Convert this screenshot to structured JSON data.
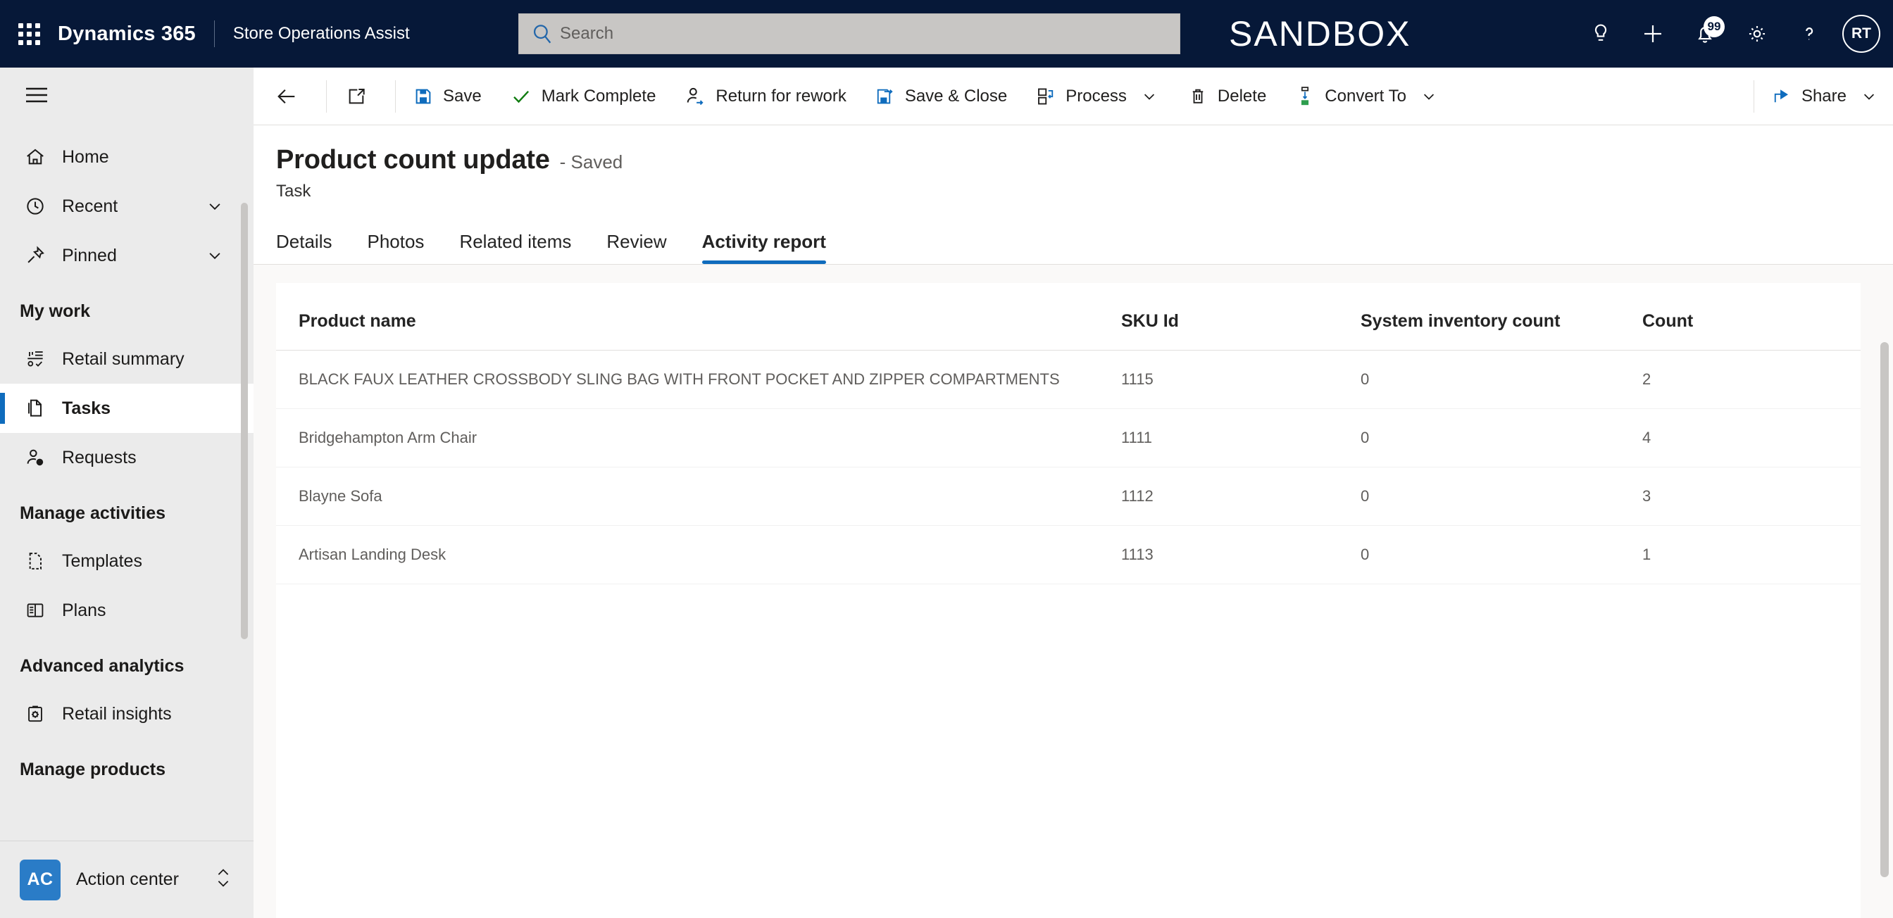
{
  "header": {
    "waffle_label": "app-launcher",
    "brand": "Dynamics 365",
    "app_name": "Store Operations Assist",
    "search_placeholder": "Search",
    "search_value": "",
    "environment_label": "SANDBOX",
    "notification_badge": "99",
    "avatar_initials": "RT",
    "icons": [
      "lightbulb-icon",
      "plus-icon",
      "bell-icon",
      "gear-icon",
      "help-icon"
    ]
  },
  "sidebar": {
    "hamburger_label": "site-map-toggle",
    "items": [
      {
        "label": "Home",
        "icon": "home-icon",
        "chevron": false,
        "selected": false
      },
      {
        "label": "Recent",
        "icon": "clock-icon",
        "chevron": true,
        "selected": false
      },
      {
        "label": "Pinned",
        "icon": "pin-icon",
        "chevron": true,
        "selected": false
      }
    ],
    "groups": [
      {
        "title": "My work",
        "items": [
          {
            "label": "Retail summary",
            "icon": "chart-icon",
            "selected": false
          },
          {
            "label": "Tasks",
            "icon": "task-icon",
            "selected": true
          },
          {
            "label": "Requests",
            "icon": "person-question-icon",
            "selected": false
          }
        ]
      },
      {
        "title": "Manage activities",
        "items": [
          {
            "label": "Templates",
            "icon": "template-icon",
            "selected": false
          },
          {
            "label": "Plans",
            "icon": "plan-icon",
            "selected": false
          }
        ]
      },
      {
        "title": "Advanced analytics",
        "items": [
          {
            "label": "Retail insights",
            "icon": "clipboard-gear-icon",
            "selected": false
          }
        ]
      },
      {
        "title": "Manage products",
        "items": []
      }
    ],
    "action_center": {
      "initials": "AC",
      "label": "Action center",
      "chevron_icon": "chevron-up-down-icon"
    }
  },
  "commandbar": {
    "back_label": "back-button",
    "popout_label": "open-in-new-window",
    "commands": [
      {
        "label": "Save",
        "icon": "save-icon",
        "chevron": false
      },
      {
        "label": "Mark Complete",
        "icon": "checkmark-icon",
        "chevron": false
      },
      {
        "label": "Return for rework",
        "icon": "person-arrow-icon",
        "chevron": false
      },
      {
        "label": "Save & Close",
        "icon": "save-close-icon",
        "chevron": false
      },
      {
        "label": "Process",
        "icon": "process-icon",
        "chevron": true
      },
      {
        "label": "Delete",
        "icon": "trash-icon",
        "chevron": false
      },
      {
        "label": "Convert To",
        "icon": "convert-icon",
        "chevron": true
      }
    ],
    "share": {
      "label": "Share",
      "icon": "share-icon",
      "chevron": true
    }
  },
  "record": {
    "title": "Product count update",
    "status": "- Saved",
    "entity": "Task"
  },
  "tabs": [
    {
      "label": "Details",
      "active": false
    },
    {
      "label": "Photos",
      "active": false
    },
    {
      "label": "Related items",
      "active": false
    },
    {
      "label": "Review",
      "active": false
    },
    {
      "label": "Activity report",
      "active": true
    }
  ],
  "table": {
    "columns": [
      "Product name",
      "SKU Id",
      "System inventory count",
      "Count"
    ],
    "rows": [
      {
        "product_name": "BLACK FAUX LEATHER CROSSBODY SLING BAG WITH FRONT POCKET AND ZIPPER COMPARTMENTS",
        "sku_id": "1115",
        "system_inventory_count": "0",
        "count": "2"
      },
      {
        "product_name": "Bridgehampton Arm Chair",
        "sku_id": "1111",
        "system_inventory_count": "0",
        "count": "4"
      },
      {
        "product_name": "Blayne Sofa",
        "sku_id": "1112",
        "system_inventory_count": "0",
        "count": "3"
      },
      {
        "product_name": "Artisan Landing Desk",
        "sku_id": "1113",
        "system_inventory_count": "0",
        "count": "1"
      }
    ]
  },
  "colors": {
    "header_bg": "#061838",
    "accent": "#0f6cbd",
    "sidebar_bg": "#ebebeb",
    "content_bg": "#faf9f8",
    "save_icon": "#0f6cbd",
    "complete_icon": "#107c10",
    "action_center_badge": "#2a7cc7"
  }
}
